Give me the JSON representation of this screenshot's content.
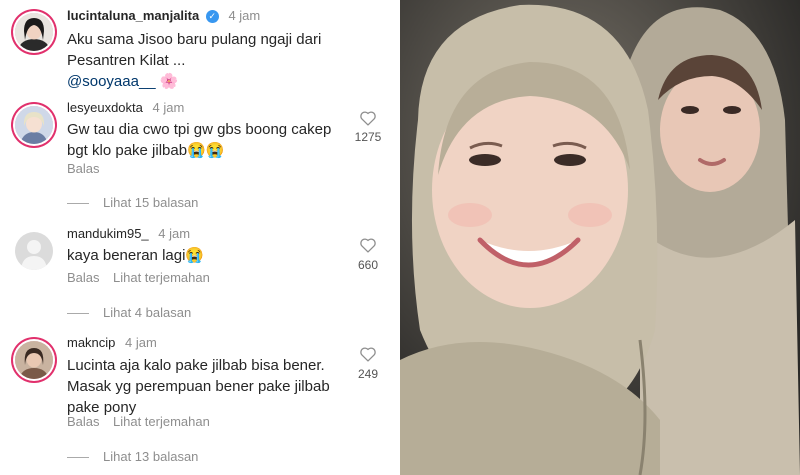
{
  "post": {
    "username": "lucintaluna_manjalita",
    "time": "4 jam",
    "caption_line1": "Aku sama Jisoo baru pulang ngaji dari",
    "caption_line2": "Pesantren Kilat ...",
    "mention": "@sooyaaa__",
    "flower_emoji": "🌸",
    "verified_icon": "✓"
  },
  "comments": [
    {
      "username": "lesyeuxdokta",
      "time": "4 jam",
      "lines": [
        "Gw tau dia cwo tpi gw gbs boong cakep",
        "bgt klo pake jilbab😭😭"
      ],
      "likes": "1275",
      "reply_label": "Balas",
      "view_replies": "Lihat 15 balasan"
    },
    {
      "username": "mandukim95_",
      "time": "4 jam",
      "lines": [
        "kaya beneran lagi😭"
      ],
      "likes": "660",
      "reply_label": "Balas",
      "translate_label": "Lihat terjemahan",
      "view_replies": "Lihat 4 balasan"
    },
    {
      "username": "makncip",
      "time": "4 jam",
      "lines": [
        "Lucinta aja kalo pake jilbab bisa bener.",
        "Masak yg perempuan bener pake jilbab",
        "pake pony"
      ],
      "likes": "249",
      "reply_label": "Balas",
      "translate_label": "Lihat terjemahan",
      "view_replies": "Lihat 13 balasan"
    }
  ],
  "icons": {
    "like": "heart-outline-icon",
    "verified": "verified-badge-icon"
  },
  "colors": {
    "story_ring": "#e1306c",
    "verified": "#3897f0",
    "mention": "#00376b",
    "muted": "#8e8e8e"
  }
}
